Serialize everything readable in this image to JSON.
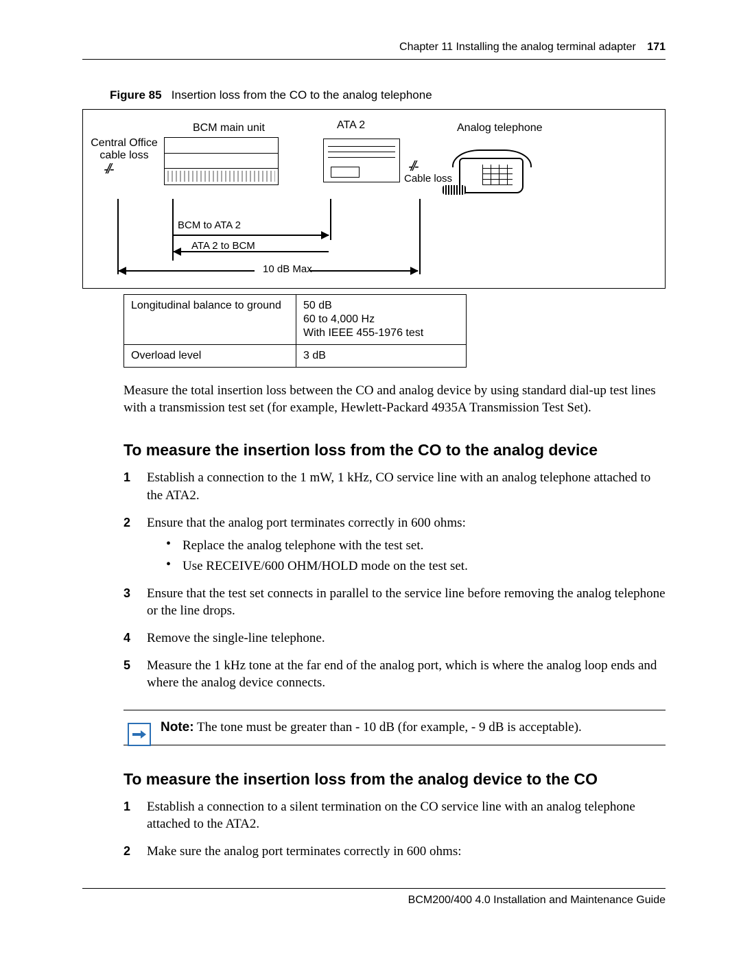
{
  "header": {
    "chapter": "Chapter 11  Installing the analog terminal adapter",
    "page": "171"
  },
  "figure": {
    "label": "Figure 85",
    "caption": "Insertion loss from the CO to the analog telephone",
    "labels": {
      "bcm": "BCM main unit",
      "ata": "ATA 2",
      "telephone": "Analog telephone",
      "central_office": "Central Office cable loss",
      "cable_loss": "Cable loss",
      "bcm_to_ata": "BCM to ATA 2",
      "ata_to_bcm": "ATA 2 to BCM",
      "max": "10 dB Max"
    }
  },
  "table": {
    "rows": [
      {
        "param": "Longitudinal balance to ground",
        "value": "50 dB\n60 to 4,000 Hz\nWith IEEE 455-1976 test"
      },
      {
        "param": "Overload level",
        "value": "3 dB"
      }
    ]
  },
  "para1": "Measure the total insertion loss between the CO and analog device by using standard dial-up test lines with a transmission test set (for example, Hewlett-Packard 4935A Transmission Test Set).",
  "section1": {
    "title": "To measure the insertion loss from the CO to the analog device",
    "steps": [
      "Establish a connection to the 1 mW, 1 kHz, CO service line with an analog telephone attached to the ATA2.",
      "Ensure that the analog port terminates correctly in 600 ohms:",
      "Ensure that the test set connects in parallel to the service line before removing the analog telephone or the line drops.",
      "Remove the single-line telephone.",
      "Measure the 1 kHz tone at the far end of the analog port, which is where the analog loop ends and where the analog device connects."
    ],
    "step2_bullets": [
      "Replace the analog telephone with the test set.",
      "Use RECEIVE/600 OHM/HOLD mode on the test set."
    ]
  },
  "note": {
    "label": "Note:",
    "text": " The tone must be greater than - 10 dB (for example, - 9 dB is acceptable)."
  },
  "section2": {
    "title": "To measure the insertion loss from the analog device to the CO",
    "steps": [
      "Establish a connection to a silent termination on the CO service line with an analog telephone attached to the ATA2.",
      "Make sure the analog port terminates correctly in 600 ohms:"
    ]
  },
  "footer": "BCM200/400 4.0 Installation and Maintenance Guide"
}
